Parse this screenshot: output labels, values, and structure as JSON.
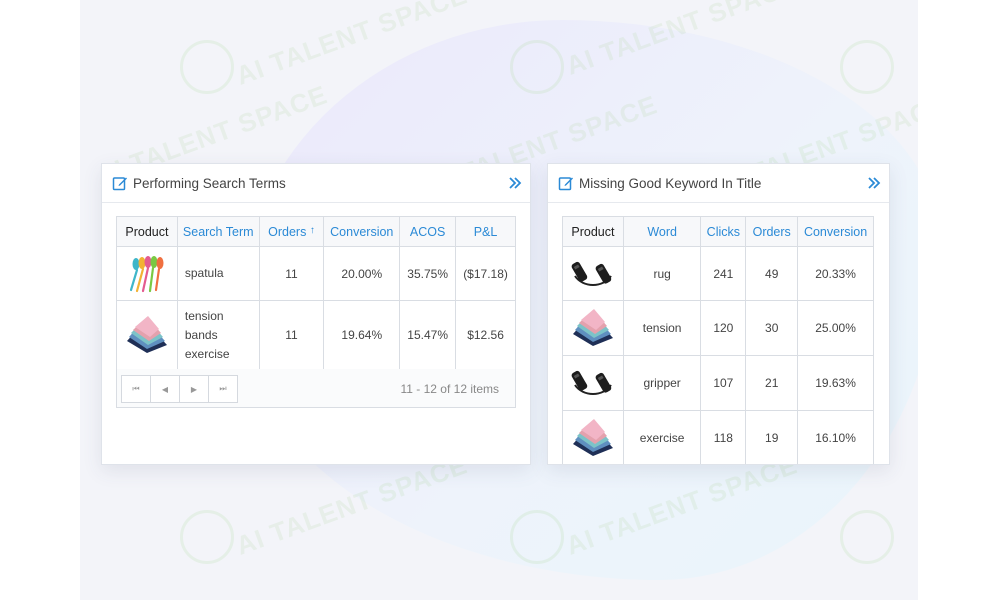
{
  "watermark_text": "AI TALENT SPACE",
  "left_panel": {
    "title": "Performing Search Terms",
    "columns": [
      "Product",
      "Search Term",
      "Orders",
      "Conversion",
      "ACOS",
      "P&L"
    ],
    "sort_indicator": "↑",
    "rows": [
      {
        "product_icon": "spatula-image",
        "term": "spatula",
        "orders": "11",
        "conversion": "20.00%",
        "acos": "35.75%",
        "pnl": "($17.18)"
      },
      {
        "product_icon": "resistance-bands-image",
        "term_lines": [
          "tension",
          "bands",
          "exercise"
        ],
        "orders": "11",
        "conversion": "19.64%",
        "acos": "15.47%",
        "pnl": "$12.56"
      }
    ],
    "pager": {
      "info": "11 - 12 of 12 items",
      "buttons": [
        "first-page-icon",
        "prev-page-icon",
        "next-page-icon",
        "last-page-icon"
      ]
    }
  },
  "right_panel": {
    "title": "Missing Good Keyword In Title",
    "columns": [
      "Product",
      "Word",
      "Clicks",
      "Orders",
      "Conversion"
    ],
    "rows": [
      {
        "product_icon": "jump-rope-image",
        "word": "rug",
        "clicks": "241",
        "orders": "49",
        "conversion": "20.33%"
      },
      {
        "product_icon": "resistance-bands-image",
        "word": "tension",
        "clicks": "120",
        "orders": "30",
        "conversion": "25.00%"
      },
      {
        "product_icon": "jump-rope-image",
        "word": "gripper",
        "clicks": "107",
        "orders": "21",
        "conversion": "19.63%"
      },
      {
        "product_icon": "resistance-bands-image",
        "word": "exercise",
        "clicks": "118",
        "orders": "19",
        "conversion": "16.10%"
      }
    ]
  },
  "colors": {
    "accent": "#2b8ad6",
    "negative": "#d9534f",
    "positive": "#1a37c7"
  }
}
